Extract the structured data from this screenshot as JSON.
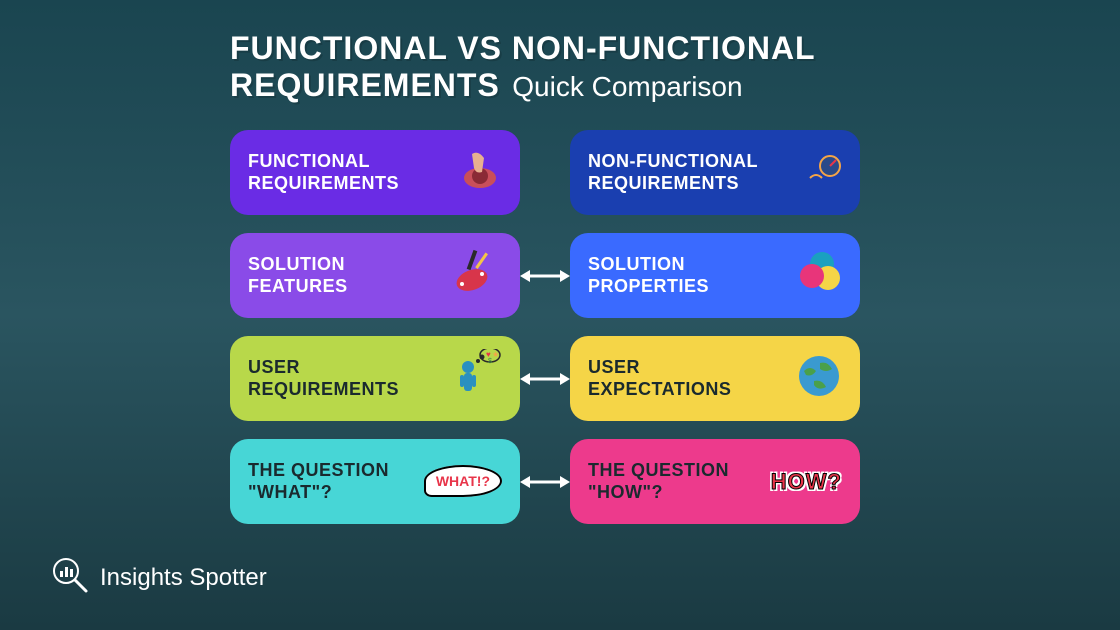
{
  "header": {
    "title_line1": "FUNCTIONAL VS NON-FUNCTIONAL",
    "title_line2": "REQUIREMENTS",
    "subtitle": "Quick Comparison"
  },
  "rows": [
    {
      "left": {
        "text": "FUNCTIONAL\nREQUIREMENTS",
        "icon": "finger-press-icon"
      },
      "right": {
        "text": "NON-FUNCTIONAL\nREQUIREMENTS",
        "icon": "gauge-icon"
      },
      "arrow": false
    },
    {
      "left": {
        "text": "SOLUTION\nFEATURES",
        "icon": "swiss-knife-icon"
      },
      "right": {
        "text": "SOLUTION\nPROPERTIES",
        "icon": "color-circles-icon"
      },
      "arrow": true
    },
    {
      "left": {
        "text": "USER\nREQUIREMENTS",
        "icon": "person-thought-icon"
      },
      "right": {
        "text": "USER\nEXPECTATIONS",
        "icon": "globe-icon"
      },
      "arrow": true
    },
    {
      "left": {
        "text": "THE QUESTION\n\"WHAT\"?",
        "icon": "what-speech-icon",
        "sticker": "WHAT!?"
      },
      "right": {
        "text": "THE QUESTION\n\"HOW\"?",
        "icon": "how-sticker-icon",
        "sticker": "HOW?"
      },
      "arrow": true
    }
  ],
  "brand": {
    "name": "Insights Spotter"
  }
}
